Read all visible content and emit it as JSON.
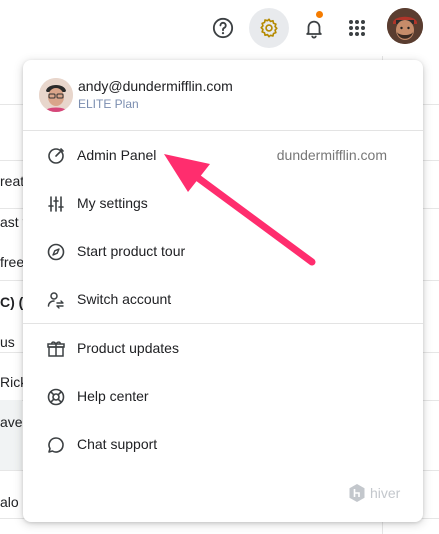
{
  "topbar": {
    "icons": [
      "help-circle-icon",
      "gear-icon",
      "bell-icon",
      "apps-grid-icon"
    ]
  },
  "background_fragments": [
    "reat",
    "ast y",
    "free",
    "C) (",
    "us",
    "Rick",
    "ave",
    "alo"
  ],
  "menu": {
    "user": {
      "email": "andy@dundermifflin.com",
      "plan": "ELITE Plan"
    },
    "items": [
      {
        "label": "Admin Panel",
        "icon": "speedometer-icon",
        "extra": "dundermifflin.com"
      },
      {
        "label": "My settings",
        "icon": "sliders-icon"
      },
      {
        "label": "Start product tour",
        "icon": "compass-icon"
      },
      {
        "label": "Switch account",
        "icon": "switch-user-icon"
      },
      {
        "label": "Product updates",
        "icon": "gift-icon"
      },
      {
        "label": "Help center",
        "icon": "lifebuoy-icon"
      },
      {
        "label": "Chat support",
        "icon": "chat-bubble-icon"
      }
    ],
    "brand": "hiver"
  },
  "colors": {
    "annotation_arrow": "#ff2d6e",
    "notification_dot": "#f57c00",
    "plan_text": "#7b8eb0"
  }
}
